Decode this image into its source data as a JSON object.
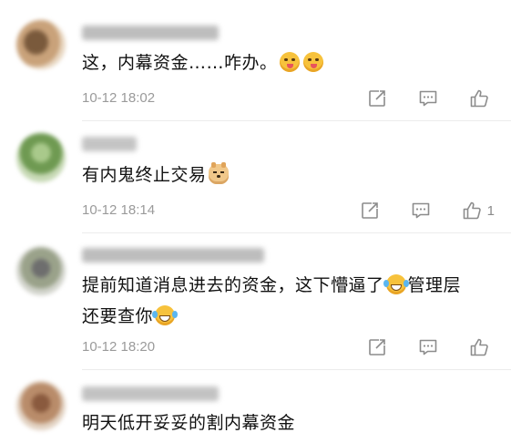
{
  "comments": [
    {
      "text": "这，内幕资金……咋办。",
      "emojis": [
        "yum-face-emoji",
        "yum-face-emoji"
      ],
      "time": "10-12 18:02",
      "likes": ""
    },
    {
      "text": "有内鬼终止交易",
      "emojis": [
        "doge-emoji"
      ],
      "time": "10-12 18:14",
      "likes": "1"
    },
    {
      "text_line1": "提前知道消息进去的资金，这下懵逼了",
      "text_line1_after": "管理层",
      "text_line2": "还要查你",
      "emojis": [
        "laughing-crying-emoji",
        "laughing-crying-emoji"
      ],
      "time": "10-12 18:20",
      "likes": ""
    },
    {
      "text": "明天低开妥妥的割内幕资金",
      "time": "",
      "likes": ""
    }
  ],
  "colors": {
    "text": "#111111",
    "meta": "#9a9a9a",
    "icon": "#8c8c8c",
    "divider": "#ececec"
  },
  "icons": {
    "repost": "repost-icon",
    "comment": "comment-icon",
    "like": "thumbs-up-icon"
  }
}
